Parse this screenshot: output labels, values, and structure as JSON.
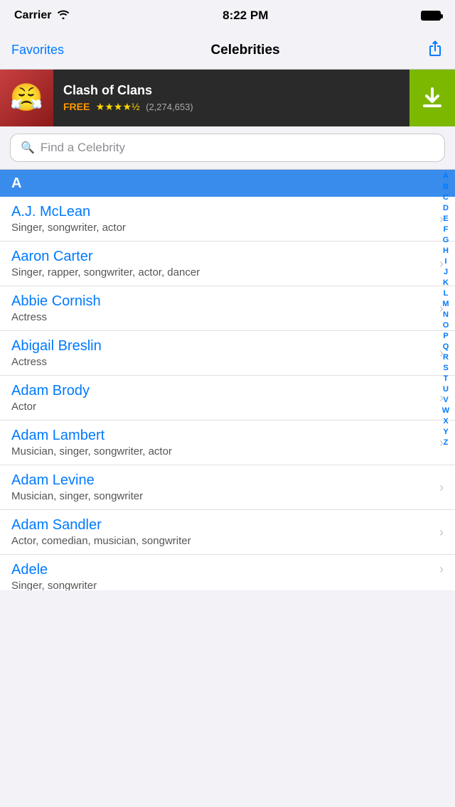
{
  "status": {
    "carrier": "Carrier",
    "wifi": "wifi",
    "time": "8:22 PM",
    "battery": "full"
  },
  "nav": {
    "favorites_label": "Favorites",
    "title": "Celebrities",
    "share_label": "Share"
  },
  "ad": {
    "icon_emoji": "😤",
    "title": "Clash of Clans",
    "free_label": "FREE",
    "stars": "★★★★½",
    "rating_count": "(2,274,653)",
    "download_label": "Download"
  },
  "search": {
    "placeholder": "Find a Celebrity"
  },
  "section": {
    "letter": "A"
  },
  "celebrities": [
    {
      "name": "A.J. McLean",
      "description": "Singer, songwriter, actor"
    },
    {
      "name": "Aaron Carter",
      "description": "Singer, rapper, songwriter, actor, dancer"
    },
    {
      "name": "Abbie Cornish",
      "description": "Actress"
    },
    {
      "name": "Abigail Breslin",
      "description": "Actress"
    },
    {
      "name": "Adam Brody",
      "description": "Actor"
    },
    {
      "name": "Adam Lambert",
      "description": "Musician, singer, songwriter, actor"
    },
    {
      "name": "Adam Levine",
      "description": "Musician, singer, songwriter"
    },
    {
      "name": "Adam Sandler",
      "description": "Actor, comedian, musician, songwriter"
    },
    {
      "name": "Adele",
      "description": "Singer, songwriter"
    }
  ],
  "alphabet": [
    "A",
    "B",
    "C",
    "D",
    "E",
    "F",
    "G",
    "H",
    "I",
    "J",
    "K",
    "L",
    "M",
    "N",
    "O",
    "P",
    "Q",
    "R",
    "S",
    "T",
    "U",
    "V",
    "W",
    "X",
    "Y",
    "Z"
  ]
}
